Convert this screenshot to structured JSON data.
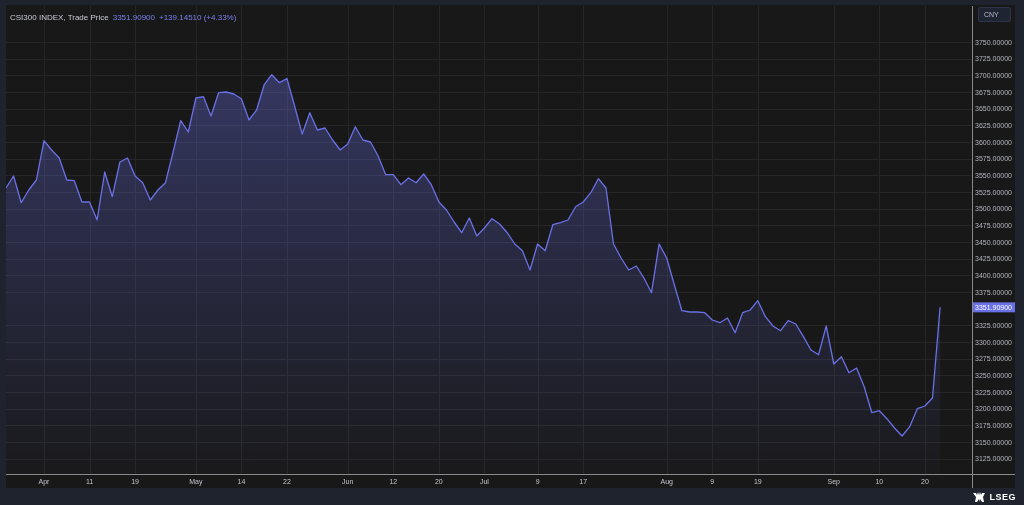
{
  "chart": {
    "legend": {
      "price": "3351.90900",
      "change": "+139.14510 (+4.33%)"
    },
    "currency": "CNY",
    "last_price_tag": "3351.90900",
    "chart_data": {
      "type": "area",
      "grid": true,
      "ylim": [
        3102,
        3804
      ],
      "categories": [
        null,
        null,
        null,
        null,
        null,
        "Apr",
        null,
        null,
        null,
        null,
        null,
        "11",
        null,
        null,
        null,
        null,
        null,
        "19",
        null,
        null,
        null,
        null,
        null,
        null,
        null,
        "May",
        null,
        null,
        null,
        null,
        null,
        "14",
        null,
        null,
        null,
        null,
        null,
        "22",
        null,
        null,
        null,
        null,
        null,
        null,
        null,
        "Jun",
        null,
        null,
        null,
        null,
        null,
        "12",
        null,
        null,
        null,
        null,
        null,
        "20",
        null,
        null,
        null,
        null,
        null,
        "Jul",
        null,
        null,
        null,
        null,
        null,
        null,
        "9",
        null,
        null,
        null,
        null,
        null,
        "17",
        null,
        null,
        null,
        null,
        null,
        null,
        null,
        null,
        null,
        null,
        "Aug",
        null,
        null,
        null,
        null,
        null,
        "9",
        null,
        null,
        null,
        null,
        null,
        "19",
        null,
        null,
        null,
        null,
        null,
        null,
        null,
        null,
        null,
        "Sep",
        null,
        null,
        null,
        null,
        null,
        "10",
        null,
        null,
        null,
        null,
        null,
        "20",
        null,
        null
      ],
      "series": [
        {
          "name": "CSI300 INDEX, Trade Price",
          "color": "#6a70e6",
          "values": [
            3531,
            3549,
            3509,
            3528,
            3543,
            3602,
            3588,
            3576,
            3543,
            3542,
            3510,
            3510,
            3483,
            3555,
            3518,
            3570,
            3576,
            3549,
            3539,
            3513,
            3528,
            3539,
            3585,
            3632,
            3615,
            3666,
            3668,
            3639,
            3674,
            3675,
            3672,
            3665,
            3633,
            3648,
            3686,
            3701,
            3689,
            3695,
            3654,
            3612,
            3644,
            3618,
            3621,
            3603,
            3588,
            3597,
            3623,
            3603,
            3600,
            3579,
            3551,
            3551,
            3536,
            3546,
            3539,
            3552,
            3536,
            3510,
            3498,
            3480,
            3464,
            3486,
            3459,
            3471,
            3485,
            3477,
            3464,
            3447,
            3437,
            3408,
            3447,
            3437,
            3476,
            3479,
            3483,
            3503,
            3510,
            3524,
            3545,
            3531,
            3447,
            3426,
            3408,
            3414,
            3396,
            3374,
            3447,
            3426,
            3386,
            3347,
            3345,
            3345,
            3344,
            3333,
            3329,
            3336,
            3314,
            3344,
            3348,
            3362,
            3338,
            3324,
            3317,
            3332,
            3327,
            3308,
            3288,
            3281,
            3324,
            3267,
            3278,
            3254,
            3261,
            3233,
            3194,
            3197,
            3185,
            3171,
            3159,
            3173,
            3200,
            3204,
            3216,
            3352
          ]
        }
      ],
      "yticks": [
        {
          "value": 3750,
          "label": "3750.00000"
        },
        {
          "value": 3725,
          "label": "3725.00000"
        },
        {
          "value": 3700,
          "label": "3700.00000"
        },
        {
          "value": 3675,
          "label": "3675.00000"
        },
        {
          "value": 3650,
          "label": "3650.00000"
        },
        {
          "value": 3625,
          "label": "3625.00000"
        },
        {
          "value": 3600,
          "label": "3600.00000"
        },
        {
          "value": 3575,
          "label": "3575.00000"
        },
        {
          "value": 3550,
          "label": "3550.00000"
        },
        {
          "value": 3525,
          "label": "3525.00000"
        },
        {
          "value": 3500,
          "label": "3500.00000"
        },
        {
          "value": 3475,
          "label": "3475.00000"
        },
        {
          "value": 3450,
          "label": "3450.00000"
        },
        {
          "value": 3425,
          "label": "3425.00000"
        },
        {
          "value": 3400,
          "label": "3400.00000"
        },
        {
          "value": 3375,
          "label": "3375.00000"
        },
        {
          "value": 3325,
          "label": "3325.00000"
        },
        {
          "value": 3300,
          "label": "3300.00000"
        },
        {
          "value": 3275,
          "label": "3275.00000"
        },
        {
          "value": 3250,
          "label": "3250.00000"
        },
        {
          "value": 3225,
          "label": "3225.00000"
        },
        {
          "value": 3200,
          "label": "3200.00000"
        },
        {
          "value": 3175,
          "label": "3175.00000"
        },
        {
          "value": 3150,
          "label": "3150.00000"
        },
        {
          "value": 3125,
          "label": "3125.00000"
        }
      ]
    }
  },
  "footer": {
    "logo_text": "LSEG"
  }
}
